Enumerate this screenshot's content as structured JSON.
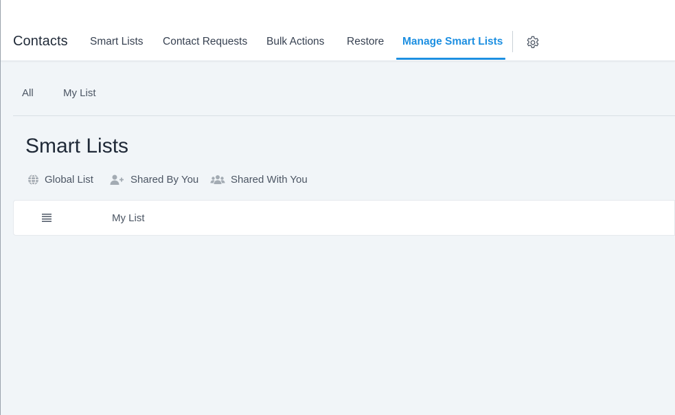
{
  "header": {
    "app_title": "Contacts",
    "tabs": [
      {
        "label": "Smart Lists",
        "active": false
      },
      {
        "label": "Contact Requests",
        "active": false
      },
      {
        "label": "Bulk Actions",
        "active": false
      },
      {
        "label": "Restore",
        "active": false
      },
      {
        "label": "Manage Smart Lists",
        "active": true
      }
    ],
    "settings_icon": "gear-icon"
  },
  "filters": {
    "tabs": [
      {
        "label": "All"
      },
      {
        "label": "My List"
      }
    ]
  },
  "main": {
    "title": "Smart Lists",
    "legend": [
      {
        "icon": "globe-icon",
        "label": "Global List"
      },
      {
        "icon": "user-plus-icon",
        "label": "Shared By You"
      },
      {
        "icon": "users-icon",
        "label": "Shared With You"
      }
    ],
    "lists": [
      {
        "icon": "drag-handle-icon",
        "name": "My List"
      }
    ]
  },
  "colors": {
    "accent": "#1d8fe1",
    "page_background": "#f1f5f8",
    "header_background": "#ffffff",
    "icon_grey": "#a3abb3"
  }
}
